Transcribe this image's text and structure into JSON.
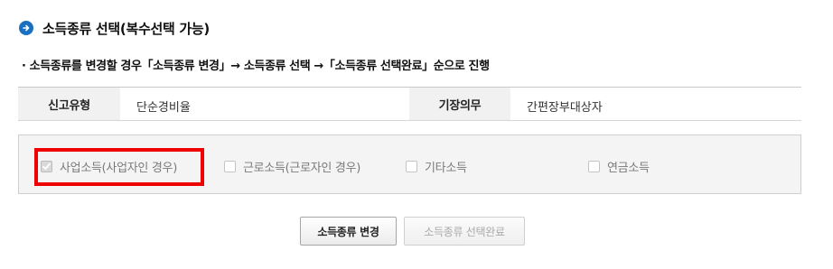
{
  "header": {
    "icon": "arrow-circle-icon",
    "accent_color": "#1a6fc0",
    "title": "소득종류 선택(복수선택 가능)"
  },
  "instruction": "· 소득종류를 변경할 경우「소득종류 변경」→ 소득종류 선택 →「소득종류 선택완료」순으로 진행",
  "info_table": {
    "report_type_label": "신고유형",
    "report_type_value": "단순경비율",
    "bookkeeping_label": "기장의무",
    "bookkeeping_value": "간편장부대상자"
  },
  "income_types": [
    {
      "label": "사업소득(사업자인 경우)",
      "checked": true,
      "disabled": true
    },
    {
      "label": "근로소득(근로자인 경우)",
      "checked": false,
      "disabled": true
    },
    {
      "label": "기타소득",
      "checked": false,
      "disabled": true
    },
    {
      "label": "연금소득",
      "checked": false,
      "disabled": true
    }
  ],
  "highlight_color": "#ee0000",
  "buttons": {
    "change_label": "소득종류 변경",
    "complete_label": "소득종류 선택완료"
  }
}
